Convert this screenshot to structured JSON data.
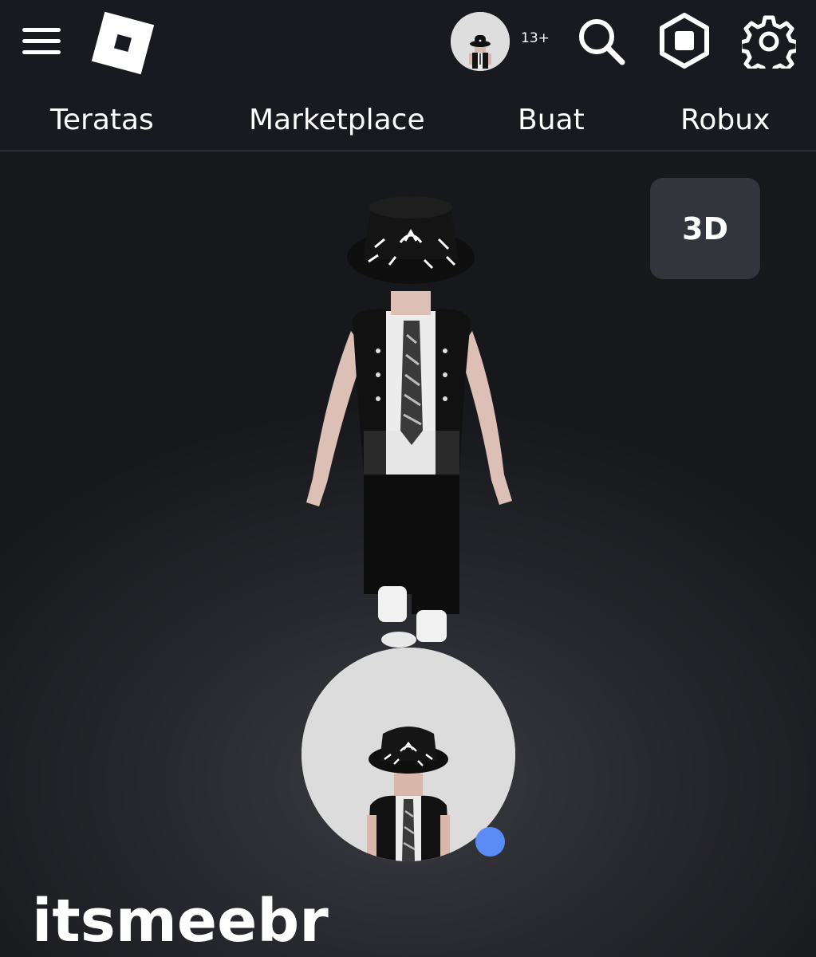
{
  "header": {
    "age_badge": "13+",
    "menu_icon": "hamburger-menu-icon",
    "logo_icon": "roblox-logo-icon",
    "search_icon": "search-icon",
    "robux_icon": "robux-icon",
    "settings_icon": "gear-icon"
  },
  "nav": {
    "tabs": [
      {
        "label": "Teratas"
      },
      {
        "label": "Marketplace"
      },
      {
        "label": "Buat"
      },
      {
        "label": "Robux"
      }
    ]
  },
  "viewer": {
    "toggle_label": "3D"
  },
  "profile": {
    "username": "itsmeebr",
    "status": "online",
    "status_color": "#5b8cf6"
  }
}
